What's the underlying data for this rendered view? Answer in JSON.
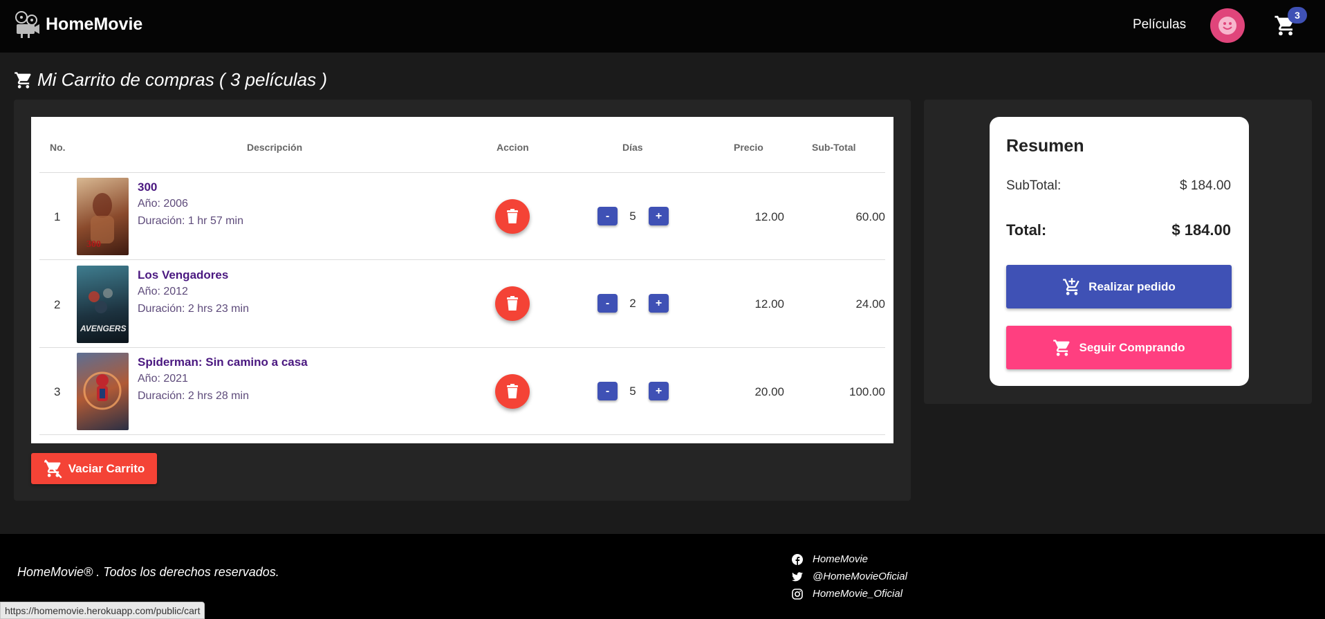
{
  "navbar": {
    "brand": "HomeMovie",
    "link_peliculas": "Películas",
    "cart_count": "3"
  },
  "page": {
    "title": "Mi Carrito de compras ( 3 películas )"
  },
  "table": {
    "headers": {
      "no": "No.",
      "description": "Descripción",
      "action": "Accion",
      "days": "Días",
      "price": "Precio",
      "subtotal": "Sub-Total"
    },
    "rows": [
      {
        "no": "1",
        "title": "300",
        "year": "Año: 2006",
        "duration": "Duración: 1 hr 57 min",
        "days": "5",
        "price": "12.00",
        "subtotal": "60.00",
        "poster_colors": [
          "#c9a781",
          "#7a3b24"
        ]
      },
      {
        "no": "2",
        "title": "Los Vengadores",
        "year": "Año: 2012",
        "duration": "Duración: 2 hrs 23 min",
        "days": "2",
        "price": "12.00",
        "subtotal": "24.00",
        "poster_colors": [
          "#2f5f74",
          "#16222c"
        ]
      },
      {
        "no": "3",
        "title": "Spiderman: Sin camino a casa",
        "year": "Año: 2021",
        "duration": "Duración: 2 hrs 28 min",
        "days": "5",
        "price": "20.00",
        "subtotal": "100.00",
        "poster_colors": [
          "#a05a3a",
          "#334466"
        ]
      }
    ],
    "minus_label": "-",
    "plus_label": "+"
  },
  "empty_cart_label": "Vaciar Carrito",
  "summary": {
    "title": "Resumen",
    "subtotal_label": "SubTotal:",
    "subtotal_value": "$ 184.00",
    "total_label": "Total:",
    "total_value": "$ 184.00",
    "order_label": "Realizar pedido",
    "continue_label": "Seguir Comprando"
  },
  "footer": {
    "copyright": "HomeMovie® . Todos los derechos reservados.",
    "social": [
      {
        "icon": "facebook-icon",
        "label": "HomeMovie"
      },
      {
        "icon": "twitter-icon",
        "label": "@HomeMovieOficial"
      },
      {
        "icon": "instagram-icon",
        "label": "HomeMovie_Oficial"
      }
    ]
  },
  "status_bar_url": "https://homemovie.herokuapp.com/public/cart",
  "colors": {
    "primary": "#3f51b5",
    "danger": "#f44336",
    "accent": "#ff3f80",
    "title_purple": "#4a1880"
  }
}
